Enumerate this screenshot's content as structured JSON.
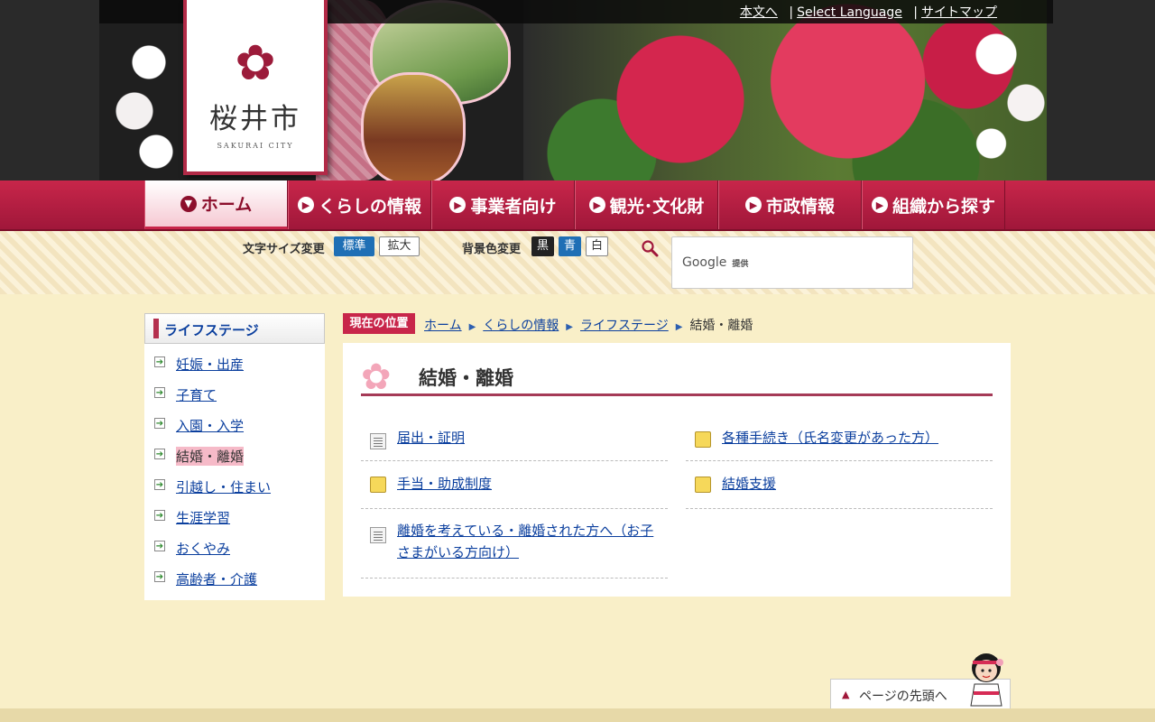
{
  "header": {
    "util_links": [
      "本文へ",
      "Select Language",
      "サイトマップ"
    ],
    "logo": {
      "mark": "✿",
      "name": "桜井市",
      "name_en": "SAKURAI CITY"
    }
  },
  "nav": {
    "items": [
      {
        "label": "ホーム",
        "icon": "triangle-down-icon"
      },
      {
        "label": "くらしの情報",
        "icon": "play-circle-icon"
      },
      {
        "label": "事業者向け",
        "icon": "play-circle-icon"
      },
      {
        "label": "観光･文化財",
        "icon": "play-circle-icon"
      },
      {
        "label": "市政情報",
        "icon": "play-circle-icon"
      },
      {
        "label": "組織から探す",
        "icon": "play-circle-icon"
      }
    ],
    "active_index": 0
  },
  "tools": {
    "font_size_label": "文字サイズ変更",
    "font_standard": "標準",
    "font_large": "拡大",
    "bg_label": "背景色変更",
    "bg_black": "黒",
    "bg_blue": "青",
    "bg_white": "白",
    "search": {
      "brand": "Google",
      "brand_suffix": "提供"
    }
  },
  "sidebar": {
    "title": "ライフステージ",
    "items": [
      {
        "label": "妊娠・出産",
        "current": false
      },
      {
        "label": "子育て",
        "current": false
      },
      {
        "label": "入園・入学",
        "current": false
      },
      {
        "label": "結婚・離婚",
        "current": true
      },
      {
        "label": "引越し・住まい",
        "current": false
      },
      {
        "label": "生涯学習",
        "current": false
      },
      {
        "label": "おくやみ",
        "current": false
      },
      {
        "label": "高齢者・介護",
        "current": false
      }
    ]
  },
  "breadcrumb": {
    "here_label": "現在の位置",
    "items": [
      "ホーム",
      "くらしの情報",
      "ライフステージ"
    ],
    "current": "結婚・離婚"
  },
  "main": {
    "title": "結婚・離婚",
    "links": [
      {
        "label": "届出・証明",
        "icon": "document-icon"
      },
      {
        "label": "各種手続き（氏名変更があった方）",
        "icon": "folder-icon"
      },
      {
        "label": "手当・助成制度",
        "icon": "folder-icon"
      },
      {
        "label": "結婚支援",
        "icon": "folder-icon"
      },
      {
        "label": "離婚を考えている・離婚された方へ（お子さまがいる方向け）",
        "icon": "document-icon"
      }
    ]
  },
  "pagetop": {
    "label": "ページの先頭へ"
  },
  "colors": {
    "accent": "#c8264a",
    "link": "#0b3f9e",
    "background": "#f9efc8"
  }
}
